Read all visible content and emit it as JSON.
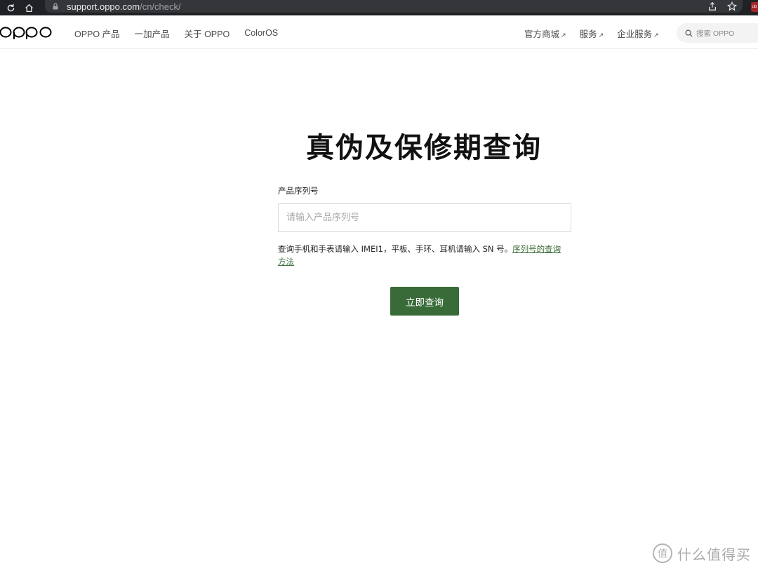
{
  "browser": {
    "url_host": "support.oppo.com",
    "url_path": "/cn/check/",
    "ext_badge": "ub"
  },
  "header": {
    "logo_text": "oppo",
    "nav_left": [
      "OPPO 产品",
      "一加产品",
      "关于 OPPO",
      "ColorOS"
    ],
    "nav_right": [
      "官方商城",
      "服务",
      "企业服务"
    ],
    "external_arrow": "↗",
    "search_placeholder": "搜索 OPPO"
  },
  "main": {
    "title": "真伪及保修期查询",
    "field_label": "产品序列号",
    "input_placeholder": "请输入产品序列号",
    "input_value": "",
    "hint_text": "查询手机和手表请输入 IMEI1，平板、手环、耳机请输入 SN 号。",
    "hint_link": "序列号的查询方法",
    "submit_label": "立即查询"
  },
  "watermark": {
    "text": "什么值得买"
  },
  "colors": {
    "accent": "#396b39",
    "link": "#3c6e3a",
    "browser_bg": "#202124"
  }
}
